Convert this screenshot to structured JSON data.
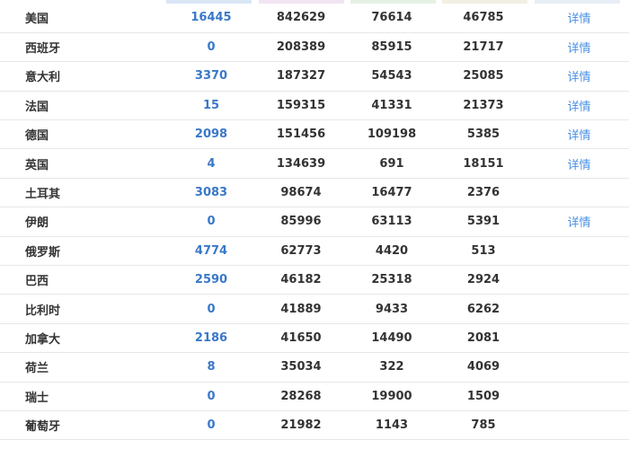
{
  "table": {
    "rows": [
      {
        "country": "美国",
        "new": "16445",
        "confirmed": "842629",
        "recovered": "76614",
        "deaths": "46785",
        "detail": "详情"
      },
      {
        "country": "西班牙",
        "new": "0",
        "confirmed": "208389",
        "recovered": "85915",
        "deaths": "21717",
        "detail": "详情"
      },
      {
        "country": "意大利",
        "new": "3370",
        "confirmed": "187327",
        "recovered": "54543",
        "deaths": "25085",
        "detail": "详情"
      },
      {
        "country": "法国",
        "new": "15",
        "confirmed": "159315",
        "recovered": "41331",
        "deaths": "21373",
        "detail": "详情"
      },
      {
        "country": "德国",
        "new": "2098",
        "confirmed": "151456",
        "recovered": "109198",
        "deaths": "5385",
        "detail": "详情"
      },
      {
        "country": "英国",
        "new": "4",
        "confirmed": "134639",
        "recovered": "691",
        "deaths": "18151",
        "detail": "详情"
      },
      {
        "country": "土耳其",
        "new": "3083",
        "confirmed": "98674",
        "recovered": "16477",
        "deaths": "2376",
        "detail": ""
      },
      {
        "country": "伊朗",
        "new": "0",
        "confirmed": "85996",
        "recovered": "63113",
        "deaths": "5391",
        "detail": "详情"
      },
      {
        "country": "俄罗斯",
        "new": "4774",
        "confirmed": "62773",
        "recovered": "4420",
        "deaths": "513",
        "detail": ""
      },
      {
        "country": "巴西",
        "new": "2590",
        "confirmed": "46182",
        "recovered": "25318",
        "deaths": "2924",
        "detail": ""
      },
      {
        "country": "比利时",
        "new": "0",
        "confirmed": "41889",
        "recovered": "9433",
        "deaths": "6262",
        "detail": ""
      },
      {
        "country": "加拿大",
        "new": "2186",
        "confirmed": "41650",
        "recovered": "14490",
        "deaths": "2081",
        "detail": ""
      },
      {
        "country": "荷兰",
        "new": "8",
        "confirmed": "35034",
        "recovered": "322",
        "deaths": "4069",
        "detail": ""
      },
      {
        "country": "瑞士",
        "new": "0",
        "confirmed": "28268",
        "recovered": "19900",
        "deaths": "1509",
        "detail": ""
      },
      {
        "country": "葡萄牙",
        "new": "0",
        "confirmed": "21982",
        "recovered": "1143",
        "deaths": "785",
        "detail": ""
      }
    ]
  }
}
